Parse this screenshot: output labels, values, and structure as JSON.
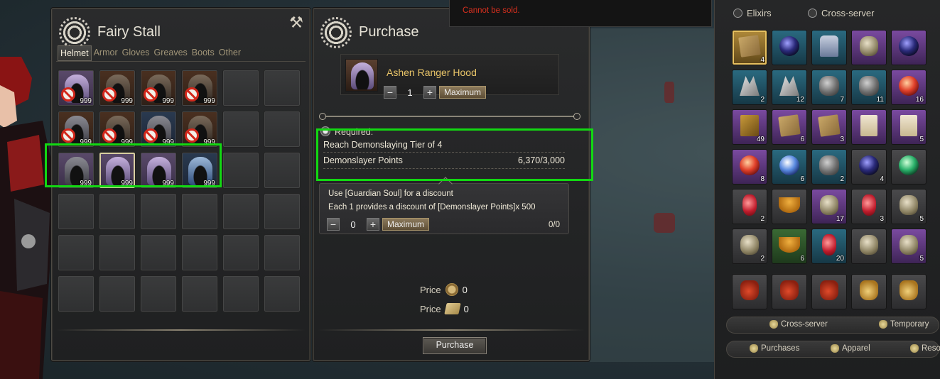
{
  "fairy_stall": {
    "title": "Fairy Stall",
    "tabs": [
      "Helmet",
      "Armor",
      "Gloves",
      "Greaves",
      "Boots",
      "Other"
    ],
    "active_tab": "Helmet",
    "items": [
      {
        "count": "999",
        "restricted": true,
        "style": "purple"
      },
      {
        "count": "999",
        "restricted": true,
        "style": "horned"
      },
      {
        "count": "999",
        "restricted": true,
        "style": "horned"
      },
      {
        "count": "999",
        "restricted": true,
        "style": "horned"
      },
      {
        "count": "999",
        "restricted": true,
        "style": "dark"
      },
      {
        "count": "999",
        "restricted": true,
        "style": "horned"
      },
      {
        "count": "999",
        "restricted": true,
        "style": "steel"
      },
      {
        "count": "999",
        "restricted": true,
        "style": "horned"
      },
      {
        "count": "999",
        "restricted": false,
        "style": "plain"
      },
      {
        "count": "999",
        "restricted": false,
        "style": "purple",
        "selected": true
      },
      {
        "count": "999",
        "restricted": false,
        "style": "purple"
      },
      {
        "count": "999",
        "restricted": false,
        "style": "blue"
      }
    ]
  },
  "purchase": {
    "title": "Purchase",
    "item_name": "Ashen Ranger Hood",
    "quantity": "1",
    "maximum_label": "Maximum",
    "required_label": "Required:",
    "req_tier": "Reach Demonslaying Tier of 4",
    "req_points_label": "Demonslayer Points",
    "req_points_value": "6,370/3,000",
    "discount_line1": "Use [Guardian Soul] for a discount",
    "discount_line2": "Each 1 provides a discount of [Demonslayer Points]x 500",
    "discount_qty": "0",
    "discount_max_label": "Maximum",
    "discount_ratio": "0/0",
    "price_label": "Price",
    "price_coin": "0",
    "price_scroll": "0",
    "purchase_button": "Purchase"
  },
  "tooltip": {
    "text": "Cannot be sold."
  },
  "inventory": {
    "filters": [
      "Elixirs",
      "Cross-server"
    ],
    "bag_tabs_row1": [
      "Cross-server",
      "Temporary"
    ],
    "bag_tabs_row2": [
      "Purchases",
      "Apparel",
      "Reso"
    ],
    "slots": [
      {
        "q": "gold",
        "g": "map",
        "c": "4"
      },
      {
        "q": "teal",
        "g": "orb-dark",
        "c": ""
      },
      {
        "q": "teal",
        "g": "armor",
        "c": ""
      },
      {
        "q": "purple",
        "g": "jar",
        "c": ""
      },
      {
        "q": "purple",
        "g": "orb-dark",
        "c": ""
      },
      {
        "q": "teal",
        "g": "claw",
        "c": "2"
      },
      {
        "q": "teal",
        "g": "claw",
        "c": "12"
      },
      {
        "q": "teal",
        "g": "rock",
        "c": "7"
      },
      {
        "q": "teal",
        "g": "rock",
        "c": "11"
      },
      {
        "q": "purple",
        "g": "orb-red",
        "c": "16"
      },
      {
        "q": "purple",
        "g": "book",
        "c": "49"
      },
      {
        "q": "purple",
        "g": "map",
        "c": "6"
      },
      {
        "q": "purple",
        "g": "map",
        "c": "3"
      },
      {
        "q": "purple",
        "g": "scroll",
        "c": ""
      },
      {
        "q": "purple",
        "g": "scroll",
        "c": "5"
      },
      {
        "q": "purple",
        "g": "orb-red",
        "c": "8"
      },
      {
        "q": "teal",
        "g": "orb-blue",
        "c": "6"
      },
      {
        "q": "teal",
        "g": "rock",
        "c": "2"
      },
      {
        "q": "plain",
        "g": "orb-dark",
        "c": "4"
      },
      {
        "q": "plain",
        "g": "orb-green",
        "c": ""
      },
      {
        "q": "plain",
        "g": "potion",
        "c": "2"
      },
      {
        "q": "plain",
        "g": "soup",
        "c": ""
      },
      {
        "q": "purple",
        "g": "jar",
        "c": "17"
      },
      {
        "q": "plain",
        "g": "potion",
        "c": "3"
      },
      {
        "q": "plain",
        "g": "jar",
        "c": "5"
      },
      {
        "q": "plain",
        "g": "jar",
        "c": "2"
      },
      {
        "q": "green",
        "g": "soup",
        "c": "6"
      },
      {
        "q": "teal",
        "g": "potion",
        "c": "20"
      },
      {
        "q": "plain",
        "g": "jar",
        "c": ""
      },
      {
        "q": "purple",
        "g": "jar",
        "c": "5"
      }
    ],
    "bags": [
      "red",
      "red",
      "red",
      "gold",
      "gold"
    ]
  },
  "colors": {
    "highlight": "#12d812",
    "item_name": "#e8c468",
    "warning": "#d8301e"
  }
}
